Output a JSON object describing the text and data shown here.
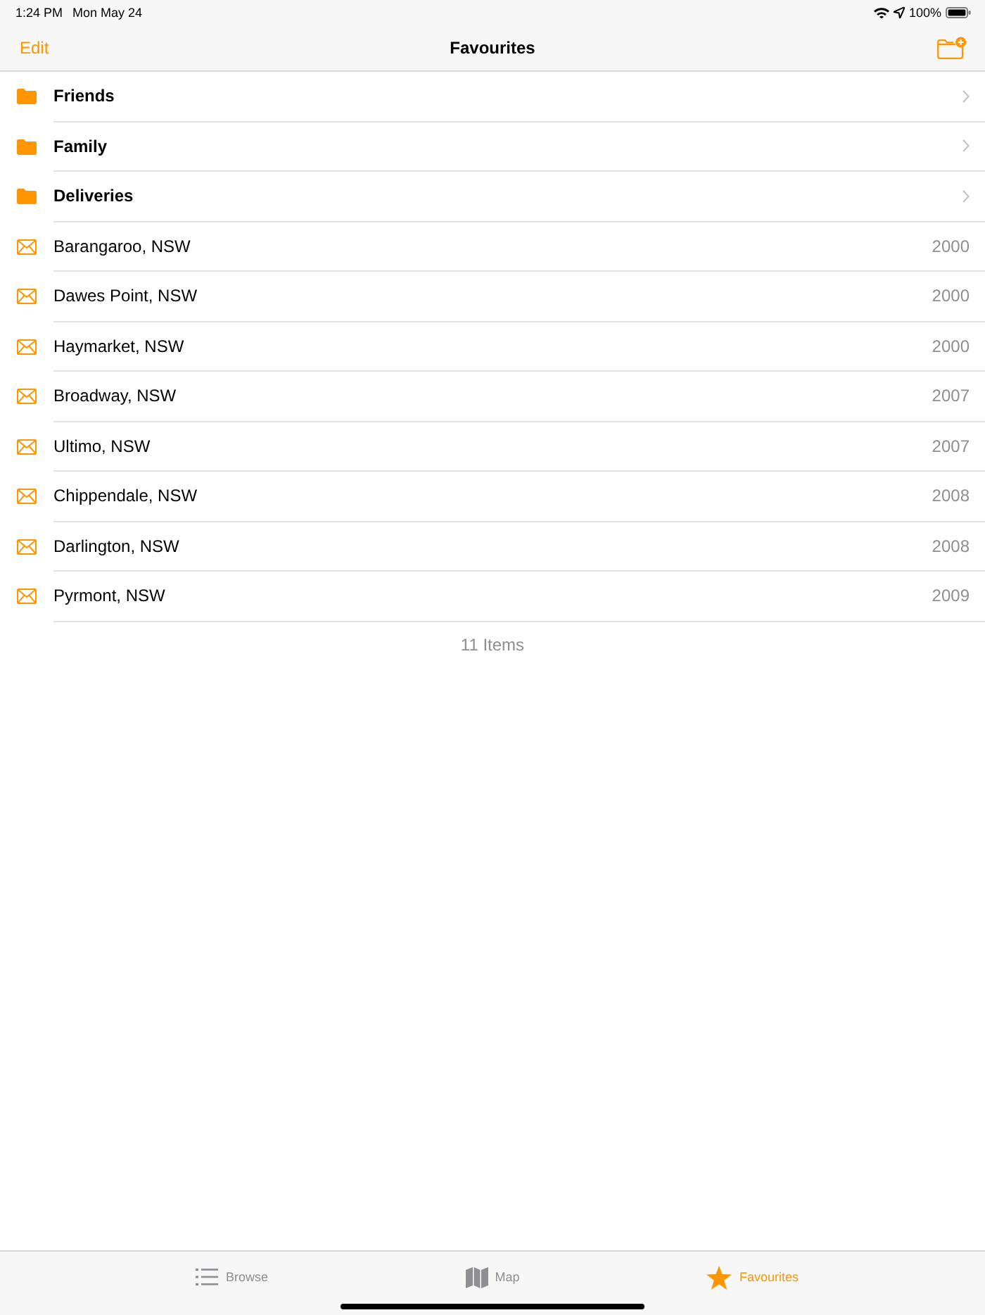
{
  "status_bar": {
    "time": "1:24 PM",
    "date": "Mon May 24",
    "battery": "100%"
  },
  "nav_bar": {
    "edit": "Edit",
    "title": "Favourites"
  },
  "rows": [
    {
      "kind": "folder",
      "label": "Friends"
    },
    {
      "kind": "folder",
      "label": "Family"
    },
    {
      "kind": "folder",
      "label": "Deliveries"
    },
    {
      "kind": "location",
      "label": "Barangaroo, NSW",
      "detail": "2000"
    },
    {
      "kind": "location",
      "label": "Dawes Point, NSW",
      "detail": "2000"
    },
    {
      "kind": "location",
      "label": "Haymarket, NSW",
      "detail": "2000"
    },
    {
      "kind": "location",
      "label": "Broadway, NSW",
      "detail": "2007"
    },
    {
      "kind": "location",
      "label": "Ultimo, NSW",
      "detail": "2007"
    },
    {
      "kind": "location",
      "label": "Chippendale, NSW",
      "detail": "2008"
    },
    {
      "kind": "location",
      "label": "Darlington, NSW",
      "detail": "2008"
    },
    {
      "kind": "location",
      "label": "Pyrmont, NSW",
      "detail": "2009"
    }
  ],
  "footer": "11 Items",
  "tab_bar": [
    {
      "kind": "list",
      "label": "Browse",
      "selected": false
    },
    {
      "kind": "map",
      "label": "Map",
      "selected": false
    },
    {
      "kind": "star",
      "label": "Favourites",
      "selected": true
    }
  ]
}
